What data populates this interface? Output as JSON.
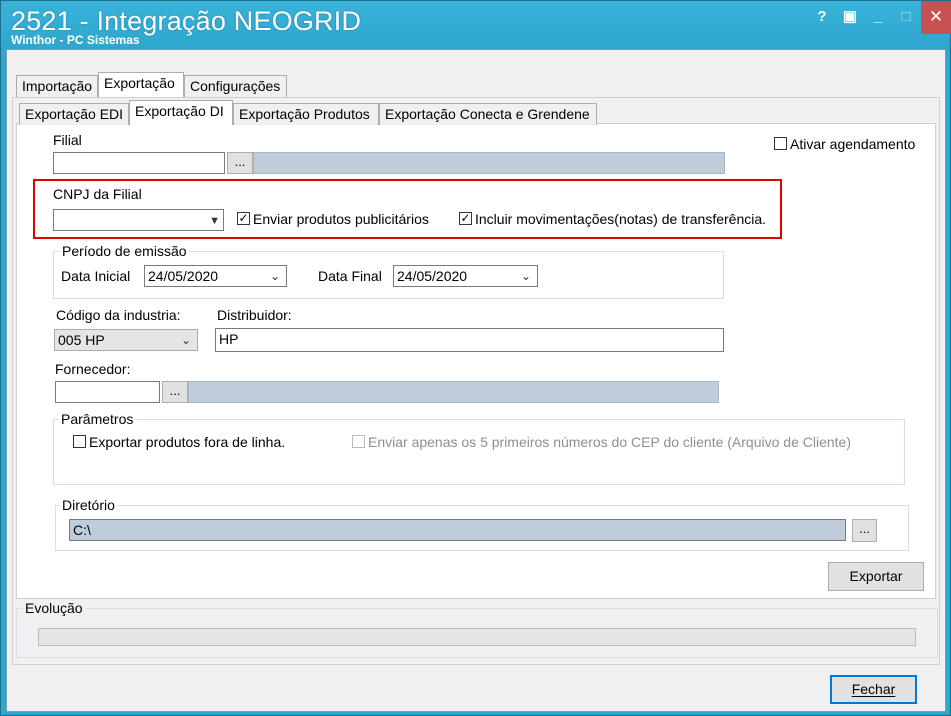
{
  "window": {
    "title": "2521 - Integração NEOGRID",
    "subtitle": "Winthor - PC Sistemas",
    "help_glyph": "?",
    "restore_glyph": "▣",
    "minimize_glyph": "_",
    "maximize_glyph": "□",
    "close_glyph": "✕"
  },
  "tabs_top": [
    {
      "label": "Importação"
    },
    {
      "label": "Exportação"
    },
    {
      "label": "Configurações"
    }
  ],
  "tabs_sub": [
    {
      "label": "Exportação EDI"
    },
    {
      "label": "Exportação DI"
    },
    {
      "label": "Exportação Produtos"
    },
    {
      "label": "Exportação Conecta e Grendene"
    }
  ],
  "filial": {
    "label": "Filial",
    "value": "",
    "lookup_label": "..."
  },
  "ativar_agendamento": {
    "label": "Ativar agendamento",
    "checked": false
  },
  "cnpj": {
    "label": "CNPJ da Filial",
    "value": "",
    "dropdown_glyph": "▼",
    "highlight_color": "#e00000"
  },
  "enviar_publicitarios": {
    "label": "Enviar produtos publicitários",
    "checked": true,
    "check_glyph": "✓"
  },
  "incluir_transferencia": {
    "label": "Incluir movimentações(notas) de transferência.",
    "checked": true,
    "check_glyph": "✓"
  },
  "periodo": {
    "title": "Período de emissão",
    "data_inicial_label": "Data Inicial",
    "data_inicial_value": "24/05/2020",
    "data_final_label": "Data Final",
    "data_final_value": "24/05/2020",
    "chevron_glyph": "⌄"
  },
  "industria": {
    "label": "Código da industria:",
    "value": "005 HP",
    "chevron_glyph": "⌄"
  },
  "distribuidor": {
    "label": "Distribuidor:",
    "value": "HP"
  },
  "fornecedor": {
    "label": "Fornecedor:",
    "value": "",
    "lookup_label": "..."
  },
  "parametros": {
    "title": "Parâmetros",
    "fora_linha_label": "Exportar produtos fora de linha.",
    "fora_linha_checked": false,
    "cep_label": "Enviar apenas os 5 primeiros números do CEP do cliente (Arquivo de Cliente)",
    "cep_checked": false
  },
  "diretorio": {
    "title": "Diretório",
    "value": "C:\\",
    "lookup_label": "..."
  },
  "exportar_label": "Exportar",
  "evolucao": {
    "title": "Evolução",
    "progress": 0
  },
  "fechar_label": "Fechar"
}
